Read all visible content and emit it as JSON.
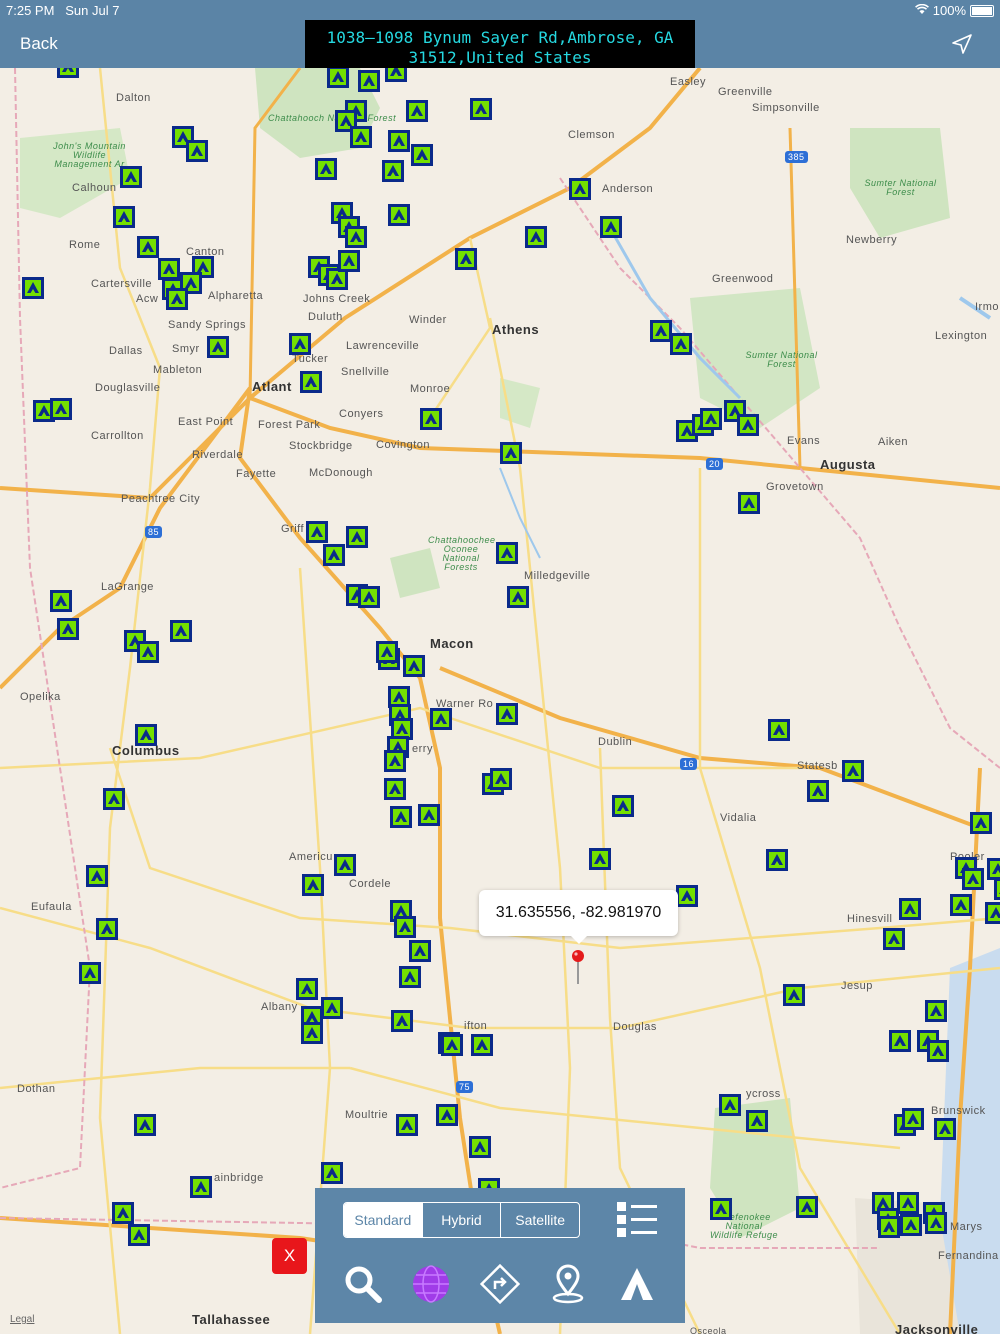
{
  "status": {
    "time": "7:25 PM",
    "date": "Sun Jul 7",
    "battery": "100%"
  },
  "nav": {
    "back": "Back",
    "address": "1038–1098 Bynum Sayer Rd,Ambrose, GA 31512,United States"
  },
  "map": {
    "callout": "31.635556, -82.981970",
    "legal": "Legal",
    "places": [
      "Dalton",
      "Greenville",
      "Easley",
      "Simpsonville",
      "Clemson",
      "Anderson",
      "Chattahoochee National Forest",
      "John's Mountain Wildlife Management Area",
      "Calhoun",
      "Rome",
      "Canton",
      "Cartersville",
      "Acworth",
      "Alpharetta",
      "Johns Creek",
      "Duluth",
      "Sandy Springs",
      "Winder",
      "Athens",
      "Dallas",
      "Smyrna",
      "Lawrenceville",
      "Tucker",
      "Snellville",
      "Mableton",
      "Atlanta",
      "Monroe",
      "Douglasville",
      "Conyers",
      "East Point",
      "Forest Park",
      "Carrollton",
      "Stockbridge",
      "Covington",
      "Riverdale",
      "Fayetteville",
      "McDonough",
      "Peachtree City",
      "Griffin",
      "Chattahoochee Oconee National Forests",
      "Milledgeville",
      "LaGrange",
      "Macon",
      "Opelika",
      "Warner Robins",
      "Columbus",
      "Perry",
      "Dublin",
      "Statesboro",
      "Vidalia",
      "Americus",
      "Cordele",
      "Pooler",
      "Eufaula",
      "Hinesville",
      "Albany",
      "Tifton",
      "Douglas",
      "Jesup",
      "Dothan",
      "Moultrie",
      "Waycross",
      "Brunswick",
      "Bainbridge",
      "Okefenokee National Wildlife Refuge",
      "St. Marys",
      "Fernandina",
      "Tallahassee",
      "Jacksonville",
      "Osceola",
      "Sumter National Forest",
      "Newberry",
      "Greenwood",
      "Lexington",
      "Irmo",
      "Evans",
      "Aiken",
      "Augusta",
      "Grovetown"
    ],
    "visible_labels": {
      "dalton": "Dalton",
      "greenville": "Greenville",
      "easley": "Easley",
      "simpsonville": "Simpsonville",
      "clemson": "Clemson",
      "anderson": "Anderson",
      "calhoun": "Calhoun",
      "rome": "Rome",
      "canton": "Canton",
      "cartersville": "Cartersville",
      "acworth": "Acw",
      "alpharetta": "Alpharetta",
      "johns_creek": "Johns Creek",
      "duluth": "Duluth",
      "sandy_springs": "Sandy Springs",
      "winder": "Winder",
      "athens": "Athens",
      "dallas": "Dallas",
      "smyrna": "Smyr",
      "lawrenceville": "Lawrenceville",
      "tucker": "Tucker",
      "snellville": "Snellville",
      "mableton": "Mableton",
      "atlanta": "Atlant",
      "monroe": "Monroe",
      "douglasville": "Douglasville",
      "conyers": "Conyers",
      "east_point": "East Point",
      "forest_park": "Forest Park",
      "carrollton": "Carrollton",
      "stockbridge": "Stockbridge",
      "covington": "Covington",
      "riverdale": "Riverdale",
      "fayetteville": "Fayette",
      "mcdonough": "McDonough",
      "peachtree": "Peachtree City",
      "griffin": "Griff",
      "milledgeville": "Milledgeville",
      "lagrange": "LaGrange",
      "macon": "Macon",
      "opelika": "Opelika",
      "warner": "Warner Ro",
      "columbus": "Columbus",
      "perry": "erry",
      "dublin": "Dublin",
      "statesboro": "Statesb",
      "vidalia": "Vidalia",
      "americus": "Americu",
      "cordele": "Cordele",
      "pooler": "Pooler",
      "eufaula": "Eufaula",
      "hinesville": "Hinesvill",
      "albany": "Albany",
      "tifton": "ifton",
      "douglas": "Douglas",
      "jesup": "Jesup",
      "dothan": "Dothan",
      "moultrie": "Moultrie",
      "waycross": "ycross",
      "brunswick": "Brunswick",
      "bainbridge": "ainbridge",
      "stmarys": "Marys",
      "fernandina": "Fernandina",
      "tallahassee": "Tallahassee",
      "jacksonville": "Jacksonville",
      "osceola": "Osceola",
      "newberry": "Newberry",
      "greenwood": "Greenwood",
      "lexington": "Lexington",
      "irmo": "Irmo",
      "evans": "Evans",
      "aiken": "Aiken",
      "augusta": "Augusta",
      "grovetown": "Grovetown",
      "chatt_nf": "Chattahooch National Forest",
      "johns_mtn": "John's Mountain Wildlife Management Ar",
      "sumter_nf": "Sumter National Forest",
      "sumter_nf2": "Sumter National Forest",
      "oconee_nf": "Chattahoochee Oconee National Forests",
      "okefenokee": "Okefenokee National Wildlife Refuge"
    },
    "shields": {
      "i385": "385",
      "i85": "85",
      "i20": "20",
      "i16": "16",
      "i75": "75"
    }
  },
  "panel": {
    "map_types": [
      "Standard",
      "Hybrid",
      "Satellite"
    ],
    "active_type": "Standard",
    "close_label": "X",
    "tools": [
      "search-icon",
      "globe-icon",
      "directions-icon",
      "pin-icon",
      "tent-icon"
    ]
  },
  "colors": {
    "bar": "#5b84a6",
    "camp_fill": "#74e000",
    "camp_border": "#0a2a8a",
    "close": "#e8161b",
    "address_text": "#25d8e0"
  }
}
